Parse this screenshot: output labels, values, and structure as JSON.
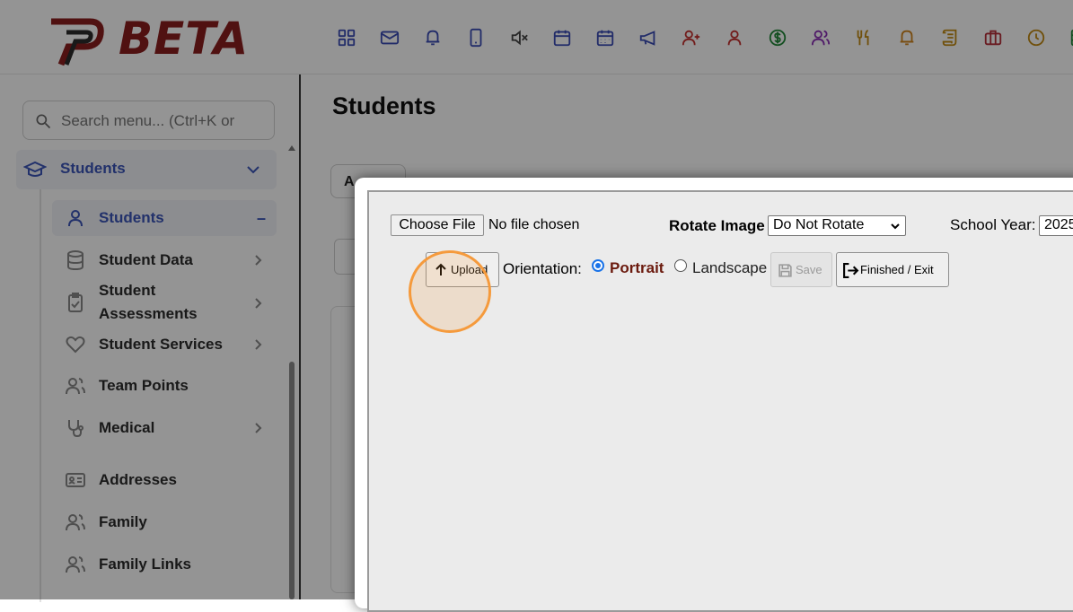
{
  "header": {
    "logo_text": "BETA",
    "toolbar_icons": [
      {
        "name": "apps-grid-icon",
        "color": "#3b4db5"
      },
      {
        "name": "mail-icon",
        "color": "#3b4db5"
      },
      {
        "name": "bell-icon",
        "color": "#3b4db5"
      },
      {
        "name": "phone-icon",
        "color": "#3b4db5"
      },
      {
        "name": "mute-icon",
        "color": "#444444"
      },
      {
        "name": "calendar-icon",
        "color": "#3b4db5"
      },
      {
        "name": "calendar-grid-icon",
        "color": "#3b4db5"
      },
      {
        "name": "megaphone-icon",
        "color": "#3b4db5"
      },
      {
        "name": "user-plus-icon",
        "color": "#c4312f"
      },
      {
        "name": "user-icon",
        "color": "#c4312f"
      },
      {
        "name": "dollar-icon",
        "color": "#23883a"
      },
      {
        "name": "users-icon",
        "color": "#8b2fb5"
      },
      {
        "name": "utensils-icon",
        "color": "#c28a14"
      },
      {
        "name": "bell-alert-icon",
        "color": "#d0861e"
      },
      {
        "name": "scroll-icon",
        "color": "#c28a14"
      },
      {
        "name": "briefcase-icon",
        "color": "#b5303a"
      },
      {
        "name": "clock-icon",
        "color": "#c28a14"
      },
      {
        "name": "table-icon",
        "color": "#23883a"
      }
    ]
  },
  "sidebar": {
    "search_placeholder": "Search menu... (Ctrl+K or",
    "section_label": "Students",
    "items": [
      {
        "label": "Students",
        "icon": "user-icon",
        "active": true,
        "marker": "–"
      },
      {
        "label": "Student Data",
        "icon": "database-icon",
        "chevron": true
      },
      {
        "label": "Student\nAssessments",
        "icon": "clipboard-check-icon",
        "chevron": true
      },
      {
        "label": "Student Services",
        "icon": "heart-icon",
        "chevron": true
      },
      {
        "label": "Team Points",
        "icon": "users-icon"
      },
      {
        "label": "Medical",
        "icon": "stethoscope-icon",
        "chevron": true
      },
      {
        "label": "Addresses",
        "icon": "id-card-icon"
      },
      {
        "label": "Family",
        "icon": "users-icon"
      },
      {
        "label": "Family Links",
        "icon": "users-icon"
      }
    ]
  },
  "main": {
    "title": "Students",
    "bg_button": "A"
  },
  "modal": {
    "choose_file": "Choose File",
    "no_file": "No file chosen",
    "rotate_label": "Rotate Image",
    "rotate_value": "Do Not Rotate",
    "school_year_label": "School Year:",
    "school_year_value": "2025",
    "upload": "Upload",
    "orientation_label": "Orientation:",
    "portrait": "Portrait",
    "landscape": "Landscape",
    "save": "Save",
    "finished": "Finished / Exit"
  }
}
